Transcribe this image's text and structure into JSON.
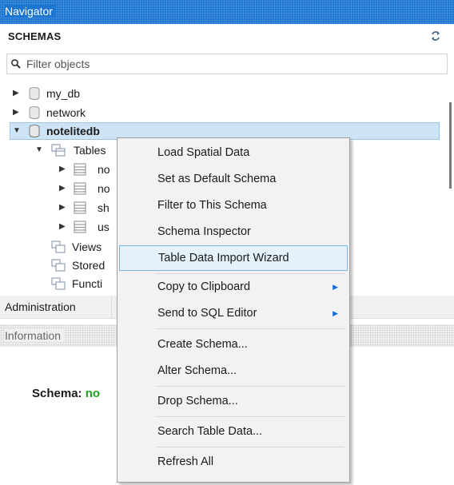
{
  "navigator": {
    "title": "Navigator",
    "schemas_title": "SCHEMAS",
    "filter_placeholder": "Filter objects"
  },
  "tree": {
    "schemas": [
      {
        "label": "my_db",
        "expanded": false
      },
      {
        "label": "network",
        "expanded": false
      },
      {
        "label": "notelitedb",
        "expanded": true,
        "selected": true
      }
    ],
    "children": {
      "tables_label": "Tables",
      "tables": [
        "no",
        "no",
        "sh",
        "us"
      ],
      "views_label": "Views",
      "stored_label": "Stored",
      "functions_label": "Functi"
    }
  },
  "tabs": {
    "administration": "Administration"
  },
  "info": {
    "header": "Information",
    "schema_label": "Schema:",
    "schema_name_visible": "no"
  },
  "context_menu": {
    "items": [
      {
        "label": "Load Spatial Data"
      },
      {
        "label": "Set as Default Schema"
      },
      {
        "label": "Filter to This Schema"
      },
      {
        "label": "Schema Inspector"
      },
      {
        "label": "Table Data Import Wizard",
        "hovered": true
      },
      {
        "label": "Copy to Clipboard",
        "submenu": true
      },
      {
        "label": "Send to SQL Editor",
        "submenu": true
      },
      {
        "label": "Create Schema..."
      },
      {
        "label": "Alter Schema..."
      },
      {
        "label": "Drop Schema..."
      },
      {
        "label": "Search Table Data..."
      },
      {
        "label": "Refresh All"
      }
    ]
  },
  "colors": {
    "header_blue": "#1b76d1",
    "selection_bg": "#cde4f7",
    "schema_name_green": "#1ea21e",
    "menu_hover": "#e5f1fb"
  }
}
